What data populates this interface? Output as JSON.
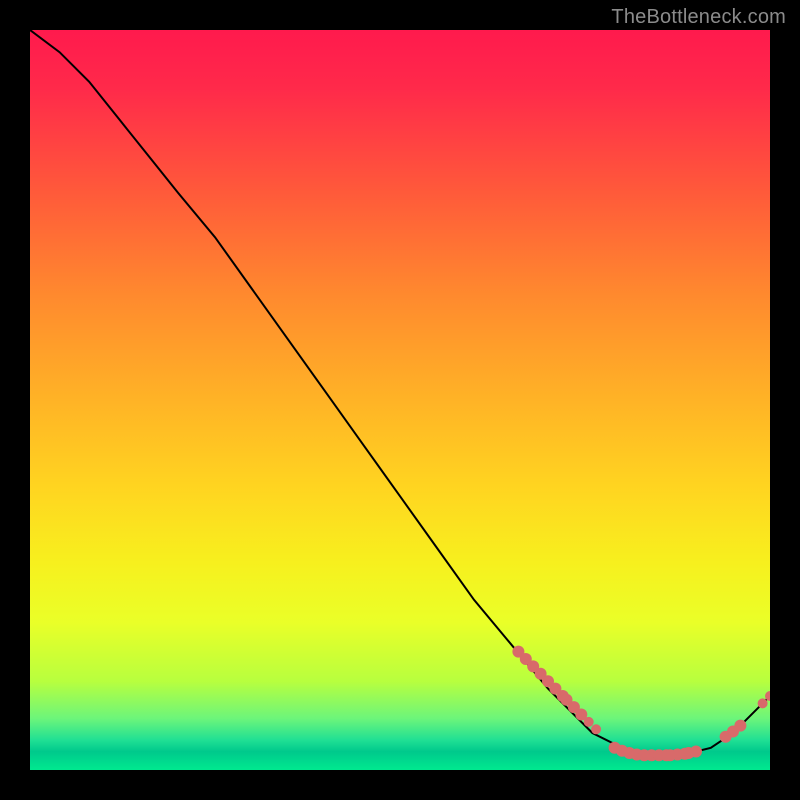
{
  "watermark": "TheBottleneck.com",
  "chart_data": {
    "type": "line",
    "title": "",
    "xlabel": "",
    "ylabel": "",
    "xlim": [
      0,
      100
    ],
    "ylim": [
      0,
      100
    ],
    "grid": false,
    "legend": false,
    "series": [
      {
        "name": "curve",
        "color": "#000000",
        "x": [
          0,
          4,
          8,
          12,
          16,
          20,
          25,
          30,
          35,
          40,
          45,
          50,
          55,
          60,
          65,
          70,
          73,
          76,
          80,
          84,
          88,
          92,
          95,
          98,
          100
        ],
        "y": [
          100,
          97,
          93,
          88,
          83,
          78,
          72,
          65,
          58,
          51,
          44,
          37,
          30,
          23,
          17,
          11,
          8,
          5,
          3,
          2,
          2,
          3,
          5,
          8,
          10
        ]
      }
    ],
    "markers": [
      {
        "name": "segment-left",
        "color": "#d86a6a",
        "shape": "circle",
        "size": 6,
        "points": [
          {
            "x": 66,
            "y": 16
          },
          {
            "x": 67,
            "y": 15
          },
          {
            "x": 68,
            "y": 14
          },
          {
            "x": 69,
            "y": 13
          },
          {
            "x": 70,
            "y": 12
          },
          {
            "x": 71,
            "y": 11
          },
          {
            "x": 72,
            "y": 10
          },
          {
            "x": 72.5,
            "y": 9.5
          },
          {
            "x": 73.5,
            "y": 8.5
          },
          {
            "x": 74.5,
            "y": 7.5
          }
        ]
      },
      {
        "name": "segment-left-dots",
        "color": "#d86a6a",
        "shape": "circle",
        "size": 5,
        "points": [
          {
            "x": 75.5,
            "y": 6.5
          },
          {
            "x": 76.5,
            "y": 5.5
          }
        ]
      },
      {
        "name": "valley-band",
        "color": "#d86a6a",
        "shape": "circle",
        "size": 6,
        "points": [
          {
            "x": 79,
            "y": 3.0
          },
          {
            "x": 80,
            "y": 2.6
          },
          {
            "x": 81,
            "y": 2.3
          },
          {
            "x": 82,
            "y": 2.1
          },
          {
            "x": 83,
            "y": 2.0
          },
          {
            "x": 84,
            "y": 2.0
          },
          {
            "x": 85,
            "y": 2.0
          },
          {
            "x": 86,
            "y": 2.0
          },
          {
            "x": 86.5,
            "y": 2.0
          },
          {
            "x": 87.5,
            "y": 2.1
          },
          {
            "x": 88.5,
            "y": 2.2
          },
          {
            "x": 89,
            "y": 2.3
          },
          {
            "x": 90,
            "y": 2.5
          }
        ]
      },
      {
        "name": "segment-right",
        "color": "#d86a6a",
        "shape": "circle",
        "size": 6,
        "points": [
          {
            "x": 94,
            "y": 4.5
          },
          {
            "x": 95,
            "y": 5.2
          },
          {
            "x": 96,
            "y": 6.0
          }
        ]
      },
      {
        "name": "tip-dots",
        "color": "#d86a6a",
        "shape": "circle",
        "size": 5,
        "points": [
          {
            "x": 99,
            "y": 9.0
          },
          {
            "x": 100,
            "y": 10.0
          }
        ]
      }
    ]
  }
}
